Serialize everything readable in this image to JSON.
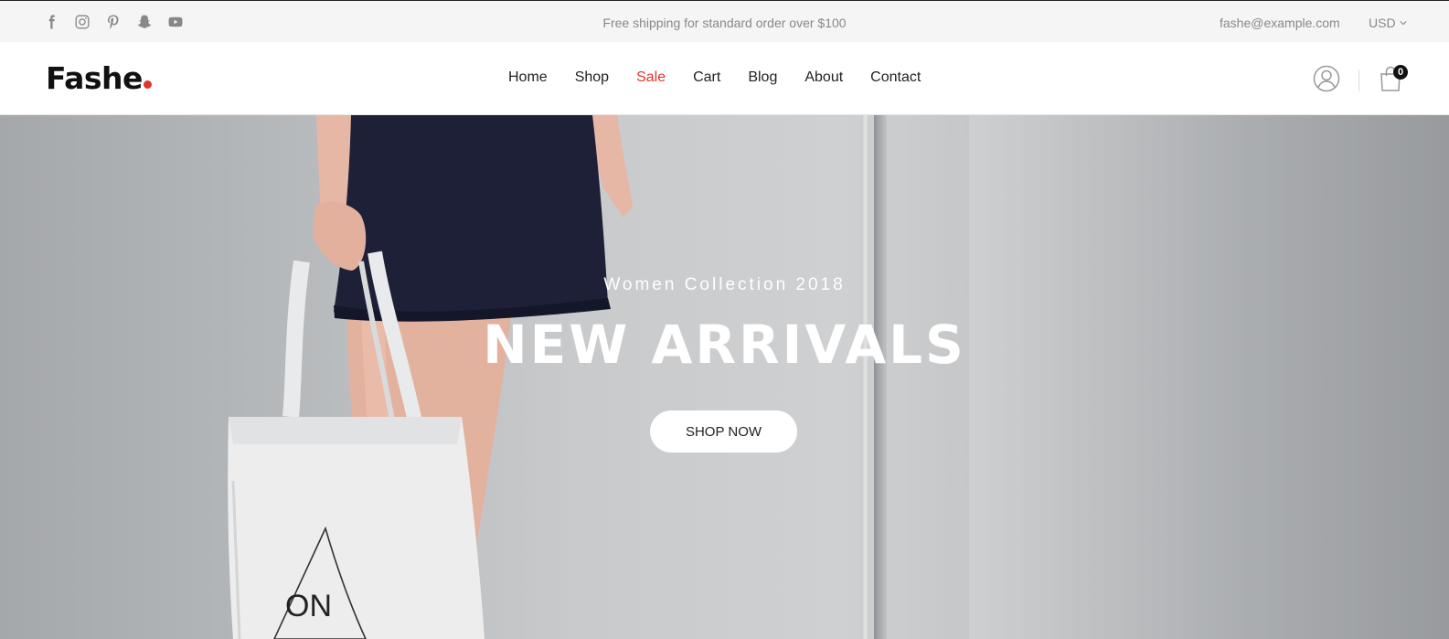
{
  "topbar": {
    "social_icons": [
      "facebook-icon",
      "instagram-icon",
      "pinterest-icon",
      "snapchat-icon",
      "youtube-icon"
    ],
    "shipping_text": "Free shipping for standard order over $100",
    "email": "fashe@example.com",
    "currency": "USD"
  },
  "header": {
    "logo": "Fashe",
    "nav": {
      "home": "Home",
      "shop": "Shop",
      "sale": "Sale",
      "cart": "Cart",
      "blog": "Blog",
      "about": "About",
      "contact": "Contact"
    },
    "cart_count": "0"
  },
  "hero": {
    "subtitle": "Women Collection 2018",
    "title": "NEW ARRIVALS",
    "button": "SHOP NOW",
    "bag_print": "ON"
  },
  "colors": {
    "accent": "#e4332b",
    "topbar_bg": "#f5f5f5",
    "text_muted": "#888888"
  }
}
